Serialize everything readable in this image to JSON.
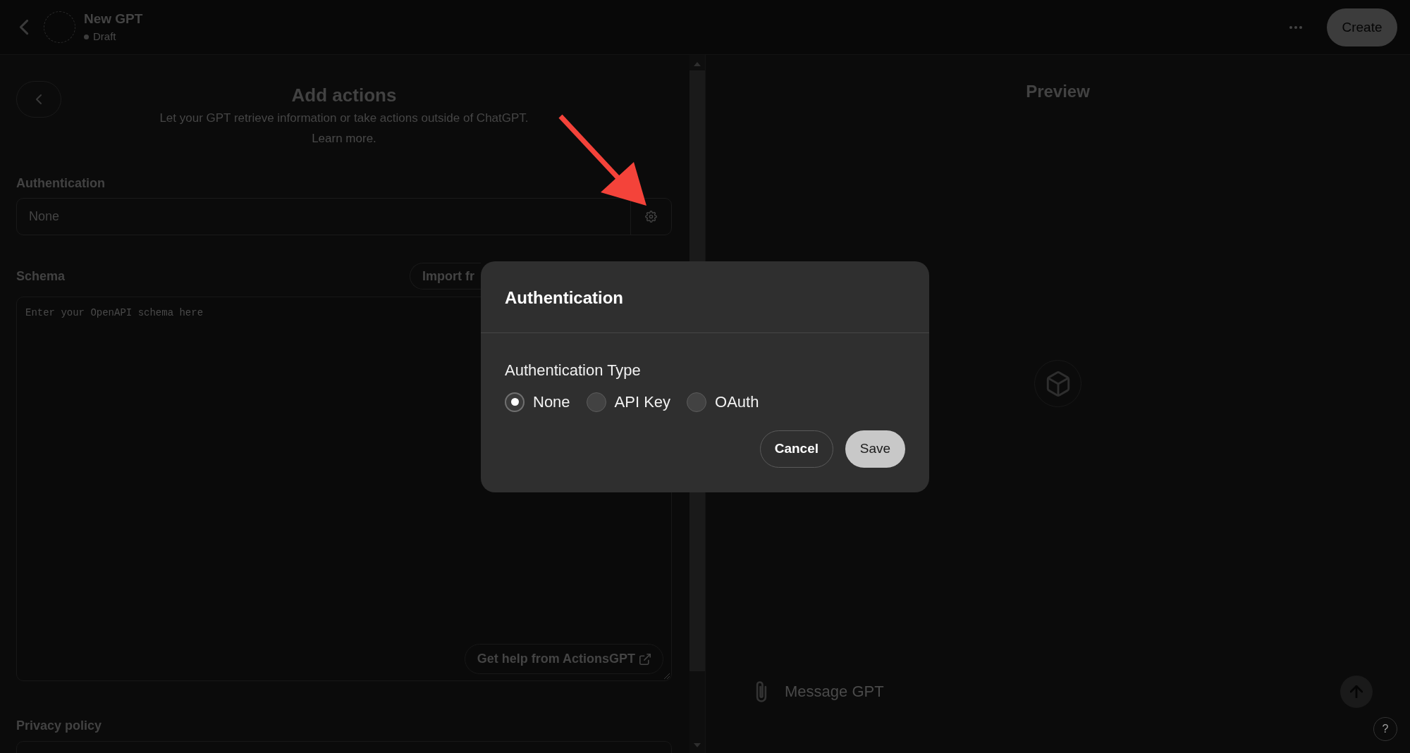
{
  "header": {
    "title": "New GPT",
    "status": "Draft",
    "create_button": "Create"
  },
  "editor": {
    "title": "Add actions",
    "subtitle": "Let your GPT retrieve information or take actions outside of ChatGPT.",
    "learn_more": "Learn more.",
    "authentication": {
      "label": "Authentication",
      "value": "None"
    },
    "schema": {
      "label": "Schema",
      "import_button": "Import fr",
      "placeholder": "Enter your OpenAPI schema here",
      "help_button": "Get help from ActionsGPT"
    },
    "privacy_policy": {
      "label": "Privacy policy"
    }
  },
  "preview": {
    "title": "Preview",
    "message_placeholder": "Message GPT",
    "help_button": "?"
  },
  "dialog": {
    "title": "Authentication",
    "field_label": "Authentication Type",
    "options": [
      {
        "label": "None",
        "selected": true
      },
      {
        "label": "API Key",
        "selected": false
      },
      {
        "label": "OAuth",
        "selected": false
      }
    ],
    "buttons": [
      {
        "label": "Cancel",
        "kind": "secondary"
      },
      {
        "label": "Save",
        "kind": "primary"
      }
    ]
  }
}
